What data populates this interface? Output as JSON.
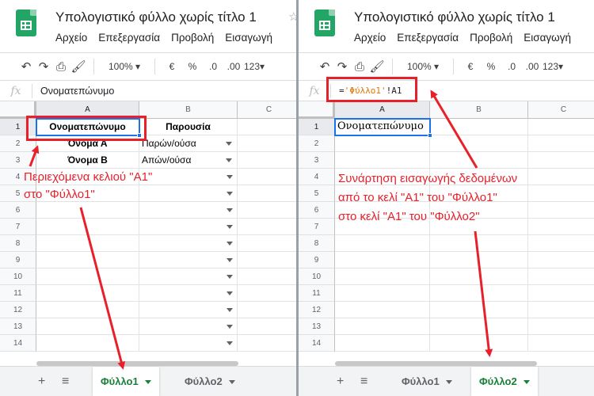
{
  "doc_title": "Υπολογιστικό φύλλο χωρίς τίτλο 1",
  "star_glyph": "☆",
  "menu": [
    "Αρχείο",
    "Επεξεργασία",
    "Προβολή",
    "Εισαγωγή"
  ],
  "toolbar": {
    "zoom": "100%",
    "currency": "€",
    "percent": "%",
    "dec_decrease": ".0",
    "dec_increase": ".00",
    "more_formats": "123"
  },
  "formula_label": "fx",
  "columns": [
    "A",
    "B",
    "C"
  ],
  "row_numbers": [
    "1",
    "2",
    "3",
    "4",
    "5",
    "6",
    "7",
    "8",
    "9",
    "10",
    "11",
    "12",
    "13",
    "14"
  ],
  "left_sheet": {
    "formula_value": "Ονοματεπώνυμο",
    "cells": {
      "a1": "Ονοματεπώνυμο",
      "b1": "Παρουσία",
      "a2": "Όνομα Α",
      "b2": "Παρών/ούσα",
      "a3": "Όνομα Β",
      "b3": "Απών/ούσα"
    },
    "active_tab": "Φύλλο1"
  },
  "right_sheet": {
    "formula_prefix": "=",
    "formula_string": "'Φύλλο1'",
    "formula_ref": "!A1",
    "cells": {
      "a1": "Ονοματεπώνυμο"
    },
    "active_tab": "Φύλλο2"
  },
  "tabs": [
    "Φύλλο1",
    "Φύλλο2"
  ],
  "annotations": {
    "left_line1": "Περιεχόμενα κελιού \"Α1\"",
    "left_line2": "στο \"Φύλλο1\"",
    "right_line1": "Συνάρτηση εισαγωγής δεδομένων",
    "right_line2": "από το κελί \"Α1\" του \"Φύλλο1\"",
    "right_line3": "στο κελί \"Α1\" του \"Φύλλο2\""
  },
  "colors": {
    "accent_red": "#e8202a",
    "sheets_green": "#188038",
    "selection_blue": "#1a73e8",
    "formula_string_orange": "#e37400"
  }
}
